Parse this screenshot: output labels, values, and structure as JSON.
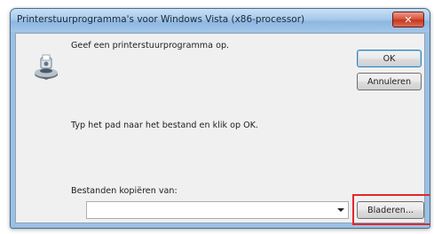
{
  "window": {
    "title": "Printerstuurprogramma's voor Windows Vista (x86-processor)",
    "close_symbol": "✕"
  },
  "dialog": {
    "prompt": "Geef een printerstuurprogramma op.",
    "instruction": "Typ het pad naar het bestand en klik op OK.",
    "copy_from_label": "Bestanden kopiëren van:",
    "path_value": "",
    "ok_label": "OK",
    "cancel_label": "Annuleren",
    "browse_label": "Bladeren..."
  },
  "icons": {
    "printer": "printer-disk-icon",
    "dropdown": "chevron-down-icon",
    "close": "close-icon"
  },
  "colors": {
    "highlight": "#e0282c",
    "close_button": "#c7361c"
  }
}
